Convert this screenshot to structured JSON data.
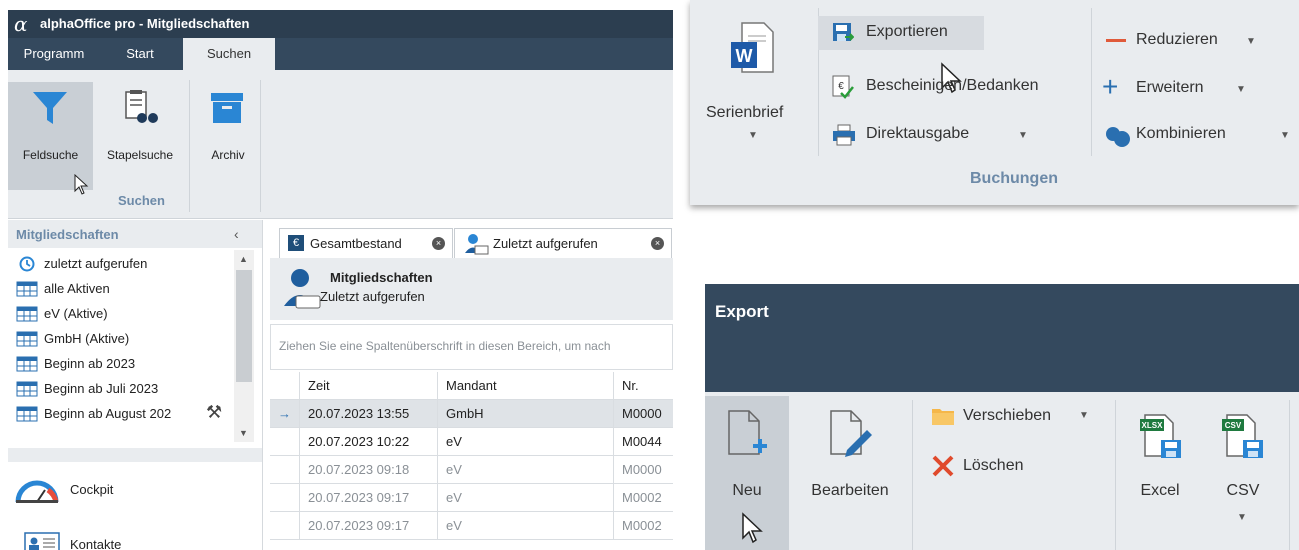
{
  "app": {
    "title": "alphaOffice pro - Mitgliedschaften",
    "menu": [
      "Programm",
      "Start",
      "Suchen"
    ],
    "ribbon_buttons": [
      "Feldsuche",
      "Stapelsuche",
      "Archiv"
    ],
    "ribbon_group": "Suchen",
    "left_panel": {
      "title": "Mitgliedschaften",
      "items": [
        {
          "label": "zuletzt aufgerufen",
          "icon": "history-icon"
        },
        {
          "label": "alle Aktiven",
          "icon": "table-icon"
        },
        {
          "label": "eV (Aktive)",
          "icon": "table-icon"
        },
        {
          "label": "GmbH (Aktive)",
          "icon": "table-icon"
        },
        {
          "label": "Beginn ab 2023",
          "icon": "table-icon"
        },
        {
          "label": "Beginn ab Juli 2023",
          "icon": "table-icon"
        },
        {
          "label": "Beginn ab August 202",
          "icon": "table-icon"
        }
      ],
      "nav": [
        "Cockpit",
        "Kontakte"
      ]
    },
    "tabs": [
      "Gesamtbestand",
      "Zuletzt aufgerufen"
    ],
    "view_title": "Mitgliedschaften",
    "view_subtitle": "Zuletzt aufgerufen",
    "group_hint": "Ziehen Sie eine Spaltenüberschrift in diesen Bereich, um nach",
    "grid": {
      "columns": [
        "Zeit",
        "Mandant",
        "Nr."
      ],
      "rows": [
        {
          "zeit": "20.07.2023 13:55",
          "mandant": "GmbH",
          "nr": "M0000",
          "current": true
        },
        {
          "zeit": "20.07.2023 10:22",
          "mandant": "eV",
          "nr": "M0044",
          "current": false
        },
        {
          "zeit": "20.07.2023 09:18",
          "mandant": "eV",
          "nr": "M0000",
          "current": false
        },
        {
          "zeit": "20.07.2023 09:17",
          "mandant": "eV",
          "nr": "M0002",
          "current": false
        },
        {
          "zeit": "20.07.2023 09:17",
          "mandant": "eV",
          "nr": "M0002",
          "current": false
        }
      ],
      "current_marker": "→"
    }
  },
  "buchungen": {
    "serienbrief": "Serienbrief",
    "items": [
      "Exportieren",
      "Bescheinigen/Bedanken",
      "Direktausgabe"
    ],
    "right_items": [
      "Reduzieren",
      "Erweitern",
      "Kombinieren"
    ],
    "group": "Buchungen"
  },
  "export": {
    "title": "Export",
    "buttons": [
      "Neu",
      "Bearbeiten"
    ],
    "items": [
      "Verschieben",
      "Löschen"
    ],
    "formats": [
      {
        "label": "Excel",
        "badge": "XLSX"
      },
      {
        "label": "CSV",
        "badge": "CSV"
      }
    ]
  },
  "colors": {
    "titlebar": "#2c3e50",
    "accent": "#2a86d4",
    "ribbon_bg": "#e9ecef",
    "group_label": "#6d8aa8"
  }
}
